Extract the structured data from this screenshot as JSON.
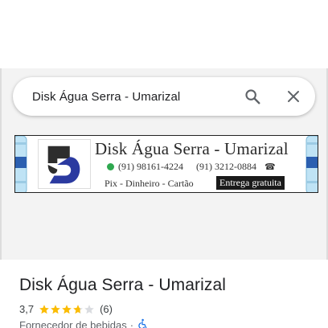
{
  "search": {
    "query": "Disk Água Serra - Umarizal"
  },
  "banner": {
    "title": "Disk Água Serra - Umarizal",
    "phone1": "(91) 98161-4224",
    "phone2": "(91) 3212-0884",
    "payments": "Pix - Dinheiro - Cartão",
    "delivery": "Entrega gratuita"
  },
  "place": {
    "name": "Disk Água Serra - Umarizal",
    "rating": "3,7",
    "rating_value": 3.7,
    "reviews": "(6)",
    "category": "Fornecedor de bebidas",
    "separator": "·"
  },
  "colors": {
    "star_filled": "#fbbc04",
    "star_empty": "#dadce0",
    "logo_blue": "#2b3aa0"
  },
  "icons": [
    "search-icon",
    "close-icon",
    "whatsapp-icon",
    "telephone-icon",
    "wheelchair-icon"
  ]
}
